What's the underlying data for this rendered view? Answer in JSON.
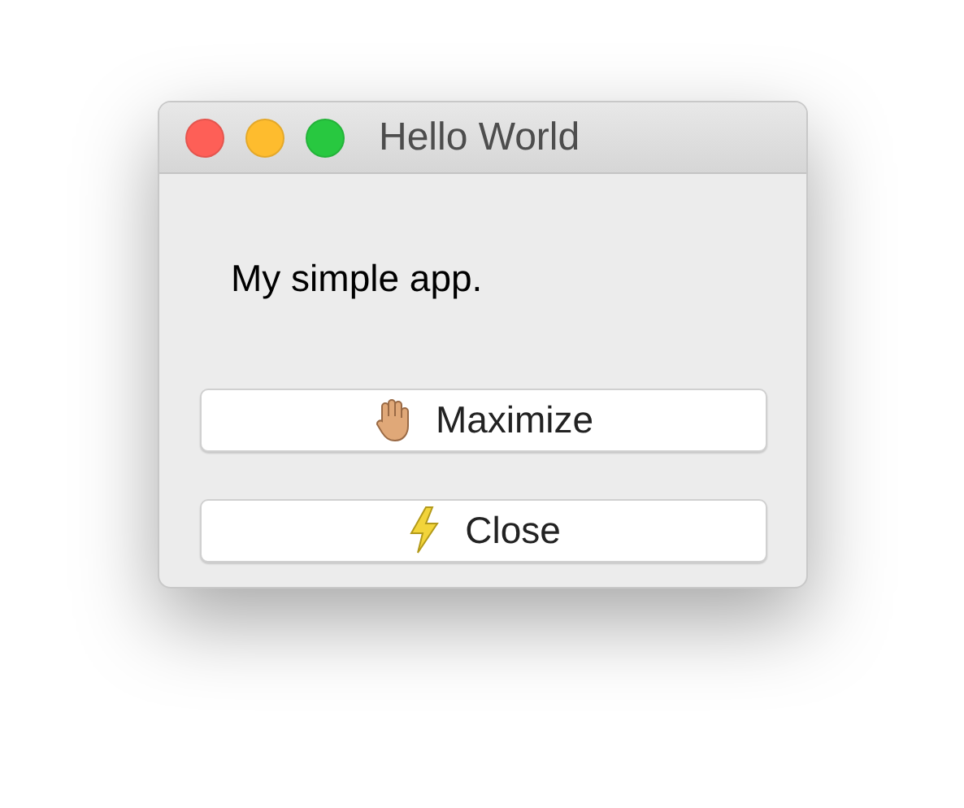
{
  "window": {
    "title": "Hello World"
  },
  "label": "My simple app.",
  "buttons": [
    {
      "label": "Maximize",
      "kind": "hand"
    },
    {
      "label": "Close",
      "kind": "bolt"
    }
  ]
}
